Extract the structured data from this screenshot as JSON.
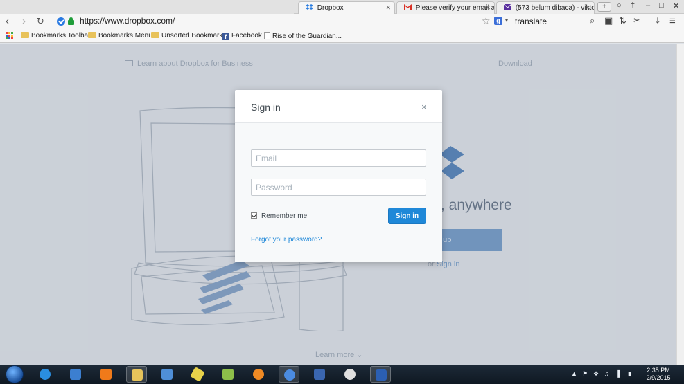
{
  "browser": {
    "tabs": [
      {
        "label": "Dropbox",
        "active": true
      },
      {
        "label": "Please verify your email ad",
        "active": false
      },
      {
        "label": "(573 belum dibaca) - vikto",
        "active": false
      }
    ],
    "new_tab_label": "+",
    "url": "https://www.dropbox.com/",
    "search_engine_letter": "g",
    "search_text": "translate",
    "bookmarks": [
      {
        "label": "Bookmarks Toolbar",
        "icon": "folder-icon"
      },
      {
        "label": "Bookmarks Menu",
        "icon": "folder-icon"
      },
      {
        "label": "Unsorted Bookmarks",
        "icon": "folder-icon"
      },
      {
        "label": "Facebook",
        "icon": "facebook-icon"
      },
      {
        "label": "Rise of the Guardian...",
        "icon": "page-icon"
      }
    ]
  },
  "page": {
    "business_link": "Learn about Dropbox for Business",
    "download_link": "Download",
    "headline_fragment": ", anywhere",
    "signup_fragment": "n up",
    "or_text": "or",
    "signin_link": "Sign in",
    "learn_more": "Learn more ⌄"
  },
  "modal": {
    "title": "Sign in",
    "close_glyph": "×",
    "email_placeholder": "Email",
    "password_placeholder": "Password",
    "remember_label": "Remember me",
    "remember_checked": true,
    "signin_button": "Sign in",
    "forgot_link": "Forgot your password?"
  },
  "taskbar": {
    "time": "2:35 PM",
    "date": "2/9/2015"
  },
  "colors": {
    "accent_blue": "#1f88d8",
    "dropbox_blue": "#3b6ed8"
  }
}
